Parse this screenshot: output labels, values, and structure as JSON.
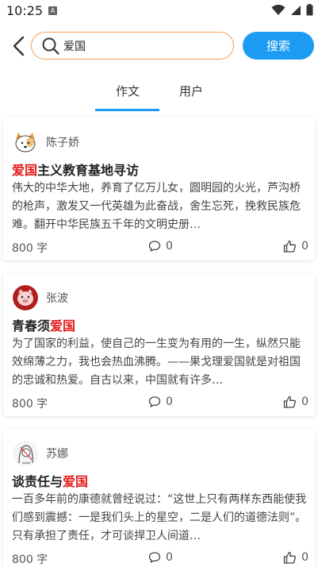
{
  "status_bar": {
    "time": "10:25",
    "notification_badge": "A"
  },
  "search": {
    "query": "爱国",
    "button_label": "搜索"
  },
  "tabs": [
    {
      "label": "作文",
      "active": true
    },
    {
      "label": "用户",
      "active": false
    }
  ],
  "accent_color": "#1c9bf2",
  "highlight_color": "#e21a1a",
  "articles": [
    {
      "author": "陈子娇",
      "avatar_icon": "cartoon-dog-avatar",
      "title_highlight": "爱国",
      "title_rest": "主义教育基地寻访",
      "excerpt": "伟大的中华大地，养育了亿万儿女，圆明园的火光，芦沟桥的枪声，激发又一代英雄为此奋战，舍生忘死，挽救民族危难。翻开中华民族五千年的文明史册…",
      "word_count": "800 字",
      "comments": "0",
      "likes": "0"
    },
    {
      "author": "张波",
      "avatar_icon": "pig-avatar",
      "title_pre": "青春须",
      "title_highlight": "爱国",
      "excerpt": "为了国家的利益，使自己的一生变为有用的一生，纵然只能效绵薄之力，我也会热血沸腾。——果戈理爱国就是对祖国的忠诚和热爱。自古以来，中国就有许多…",
      "word_count": "800 字",
      "comments": "0",
      "likes": "0"
    },
    {
      "author": "苏娜",
      "avatar_icon": "sketch-girl-avatar",
      "title_pre": "谈责任与",
      "title_highlight": "爱国",
      "excerpt": "一百多年前的康德就曾经说过：“这世上只有两样东西能使我们感到震撼：一是我们头上的星空，二是人们的道德法则”。只有承担了责任，才可谈捍卫人间道…",
      "word_count": "800 字",
      "comments": "0",
      "likes": "0"
    }
  ]
}
